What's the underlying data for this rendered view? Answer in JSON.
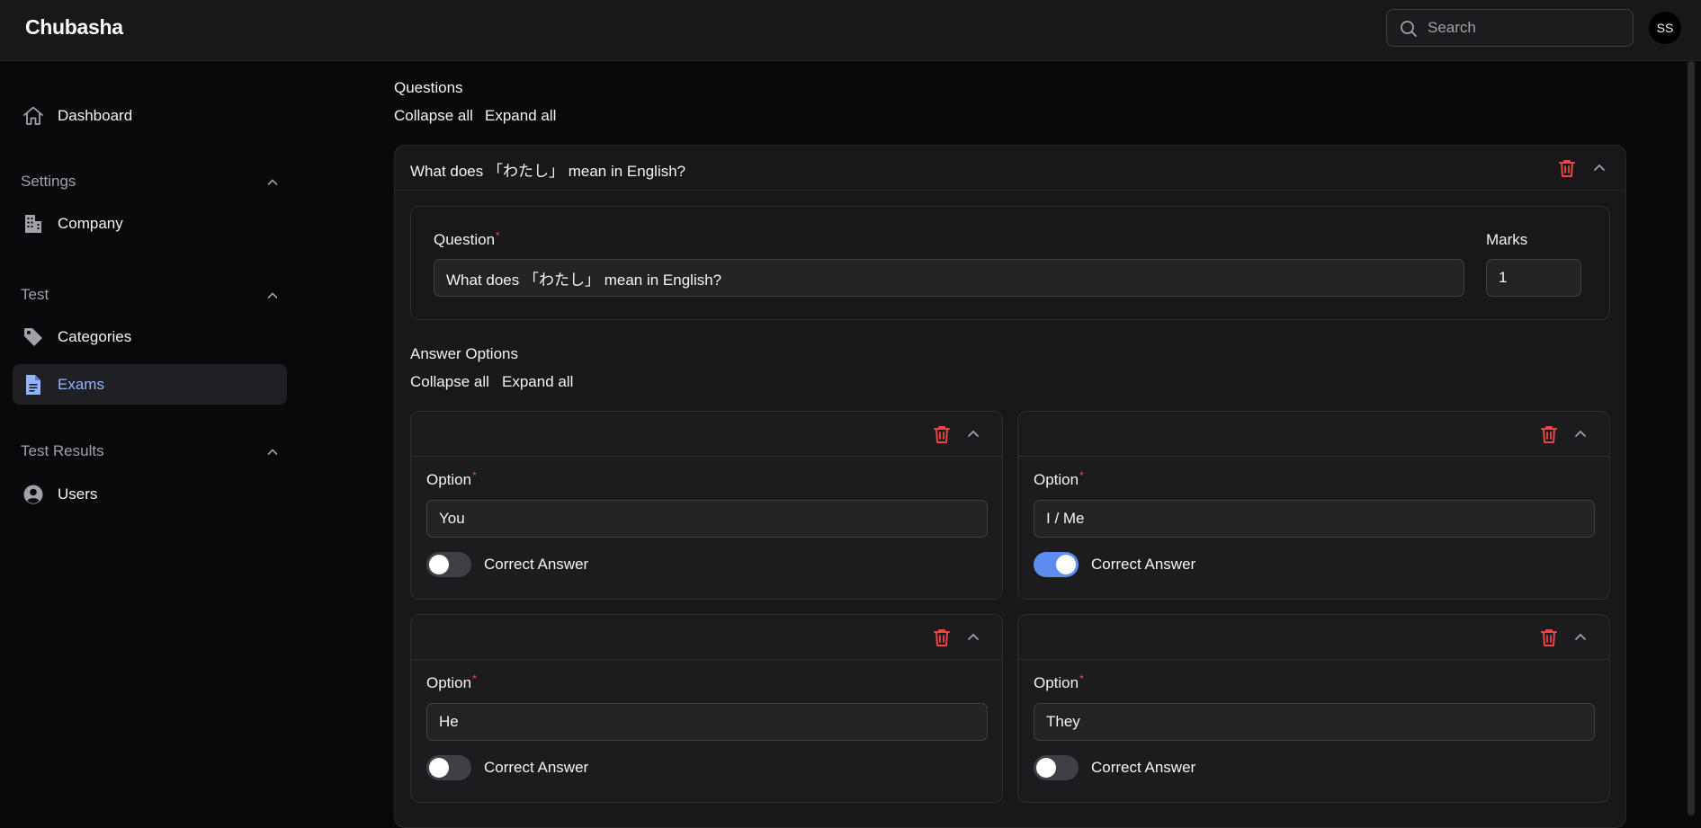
{
  "app": {
    "brand": "Chubasha"
  },
  "header": {
    "search_placeholder": "Search",
    "avatar_initials": "SS"
  },
  "sidebar": {
    "dashboard": "Dashboard",
    "groups": {
      "settings": {
        "label": "Settings",
        "items": {
          "company": "Company"
        }
      },
      "test": {
        "label": "Test",
        "items": {
          "categories": "Categories",
          "exams": "Exams"
        }
      },
      "test_results": {
        "label": "Test Results",
        "items": {
          "users": "Users"
        }
      }
    },
    "active_item": "Exams"
  },
  "questions": {
    "section_label": "Questions",
    "collapse_all": "Collapse all",
    "expand_all": "Expand all",
    "question_title": "What does 「わたし」 mean in English?",
    "question_label": "Question",
    "question_value": "What does 「わたし」 mean in English?",
    "marks_label": "Marks",
    "marks_value": "1",
    "answer_options": {
      "section_label": "Answer Options",
      "collapse_all": "Collapse all",
      "expand_all": "Expand all",
      "option_label": "Option",
      "correct_label": "Correct Answer",
      "items": [
        {
          "value": "You",
          "correct": false
        },
        {
          "value": "I / Me",
          "correct": true
        },
        {
          "value": "He",
          "correct": false
        },
        {
          "value": "They",
          "correct": false
        }
      ]
    }
  },
  "colors": {
    "accent": "#5b8def",
    "danger": "#ef4444",
    "active_nav_text": "#93b4ff"
  }
}
